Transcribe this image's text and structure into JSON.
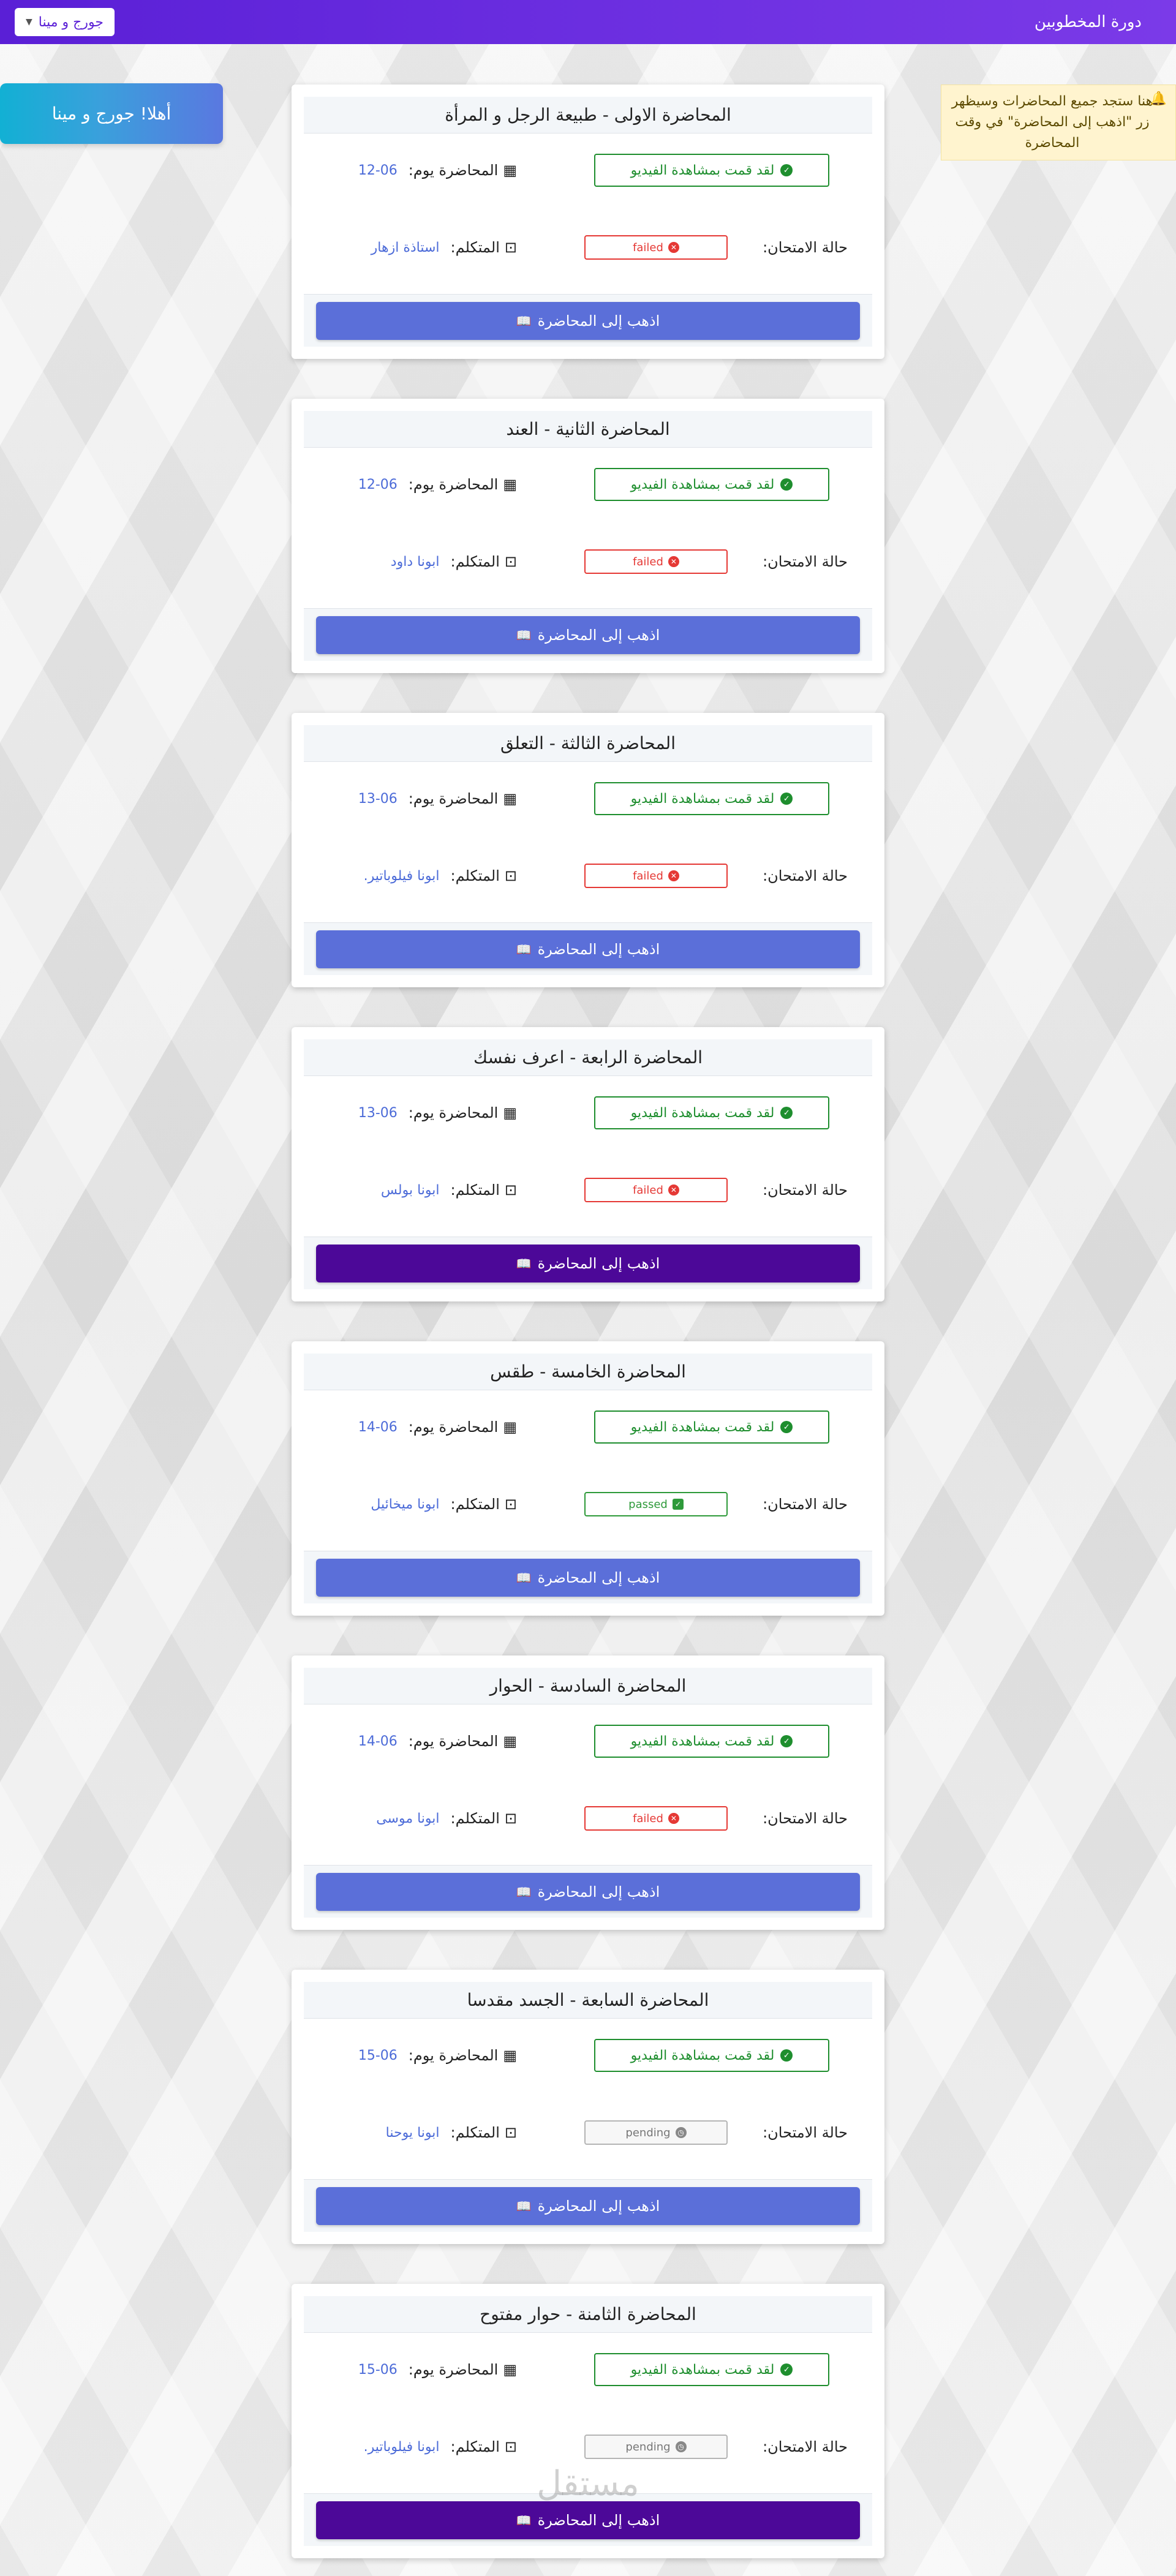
{
  "header": {
    "brand": "دورة المخطوبين",
    "user_menu_label": "جورج و مينا"
  },
  "notice": {
    "text": "هنا ستجد جميع المحاضرات وسيظهر زر \"اذهب إلى المحاضرة\" في وقت المحاضرة"
  },
  "welcome": {
    "text": "أهلا! جورج و مينا"
  },
  "labels": {
    "lecture_day": "المحاضرة يوم:",
    "speaker": "المتكلم:",
    "exam_status": "حالة الامتحان:",
    "video_watched": "لقد قمت بمشاهدة الفيديو",
    "go_button": "اذهب إلى المحاضرة"
  },
  "lectures": [
    {
      "title": "المحاضرة الاولى - طبيعة الرجل و المرأة",
      "date": "12-06",
      "speaker": "استاذة ازهار",
      "exam": "failed",
      "button_state": "default"
    },
    {
      "title": "المحاضرة الثانية - العند",
      "date": "12-06",
      "speaker": "ابونا داود",
      "exam": "failed",
      "button_state": "default"
    },
    {
      "title": "المحاضرة الثالثة - التعلق",
      "date": "13-06",
      "speaker": "ابونا فيلوباتير.",
      "exam": "failed",
      "button_state": "default"
    },
    {
      "title": "المحاضرة الرابعة - اعرف نفسك",
      "date": "13-06",
      "speaker": "ابونا بولس",
      "exam": "failed",
      "button_state": "active"
    },
    {
      "title": "المحاضرة الخامسة - طقس",
      "date": "14-06",
      "speaker": "ابونا ميخائيل",
      "exam": "passed",
      "button_state": "default"
    },
    {
      "title": "المحاضرة السادسة - الحوار",
      "date": "14-06",
      "speaker": "ابونا موسى",
      "exam": "failed",
      "button_state": "default"
    },
    {
      "title": "المحاضرة السابعة - الجسد مقدسا",
      "date": "15-06",
      "speaker": "ابونا يوحنا",
      "exam": "pending",
      "button_state": "default"
    },
    {
      "title": "المحاضرة الثامنة - حوار مفتوح",
      "date": "15-06",
      "speaker": "ابونا فيلوباتير.",
      "exam": "pending",
      "button_state": "active"
    }
  ],
  "watermark": "مستقل",
  "colors": {
    "topbar": "#5a1fd6",
    "button": "#5b6fd9",
    "button_active": "#4c0898",
    "success": "#1e8e2e",
    "danger": "#e53935"
  },
  "icons": {
    "bell": "bell-icon",
    "calendar": "calendar-icon",
    "speaker": "chalkboard-teacher-icon",
    "check": "check-circle-icon",
    "book": "book-open-icon"
  }
}
